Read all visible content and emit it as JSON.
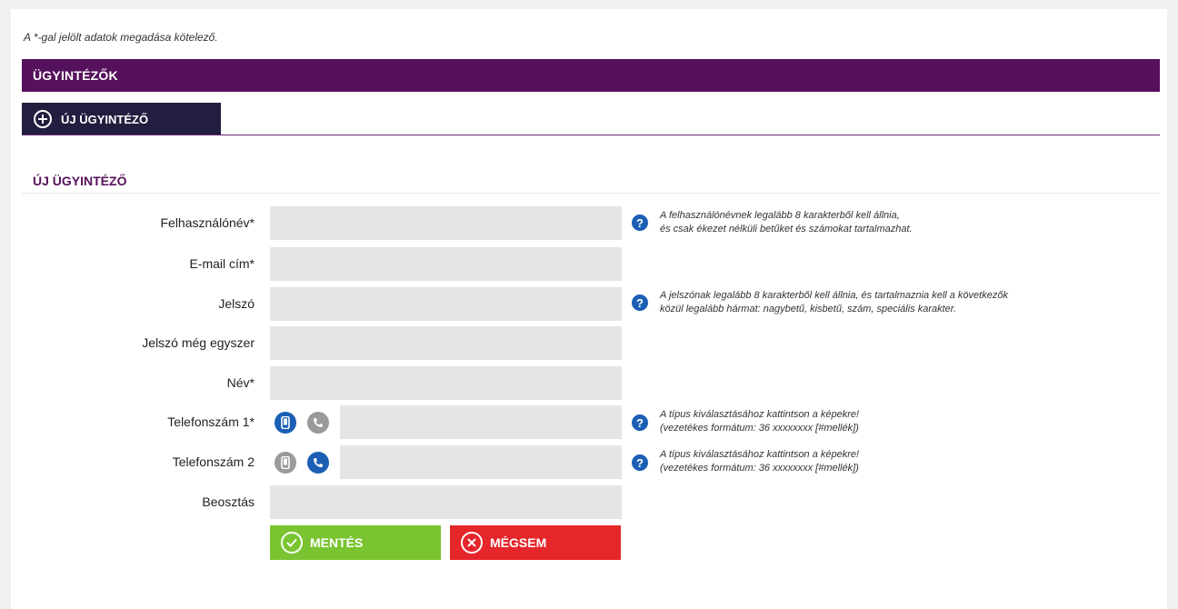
{
  "required_note": "A *-gal jelölt adatok megadása kötelező.",
  "section_title": "ÜGYINTÉZŐK",
  "new_button_label": "ÚJ ÜGYINTÉZŐ",
  "form_title": "ÚJ ÜGYINTÉZŐ",
  "fields": {
    "username": {
      "label": "Felhasználónév*",
      "value": ""
    },
    "email": {
      "label": "E-mail cím*",
      "value": ""
    },
    "password": {
      "label": "Jelszó",
      "value": ""
    },
    "password_again": {
      "label": "Jelszó még egyszer",
      "value": ""
    },
    "name": {
      "label": "Név*",
      "value": ""
    },
    "phone1": {
      "label": "Telefonszám 1*",
      "value": "",
      "selected_type": "mobile"
    },
    "phone2": {
      "label": "Telefonszám 2",
      "value": "",
      "selected_type": "landline"
    },
    "position": {
      "label": "Beosztás",
      "value": ""
    }
  },
  "hints": {
    "username_line1": "A felhasználónévnek legalább 8 karakterből kell állnia,",
    "username_line2": "és csak ékezet nélküli betűket és számokat tartalmazhat.",
    "password_line1": "A jelszónak legalább 8 karakterből kell állnia, és tartalmaznia kell a következők",
    "password_line2": "közül legalább hármat: nagybetű, kisbetű, szám, speciális karakter.",
    "phone1_line1": "A típus kiválasztásához kattintson a képekre!",
    "phone1_line2": "(vezetékes formátum: 36 xxxxxxxx [#mellék])",
    "phone2_line1": "A típus kiválasztásához kattintson a képekre!",
    "phone2_line2": "(vezetékes formátum: 36 xxxxxxxx [#mellék])",
    "help_glyph": "?"
  },
  "buttons": {
    "save": "MENTÉS",
    "cancel": "MÉGSEM"
  },
  "colors": {
    "header_purple": "#55115b",
    "new_button_navy": "#231d3f",
    "accent_blue": "#1a5fb4",
    "save_green": "#7ac431",
    "cancel_red": "#e5262b"
  },
  "icons": {
    "new_button": "plus-circle-icon",
    "help": "question-circle-icon",
    "mobile": "mobile-phone-icon",
    "landline": "handset-icon",
    "save": "check-circle-icon",
    "cancel": "x-circle-icon"
  }
}
